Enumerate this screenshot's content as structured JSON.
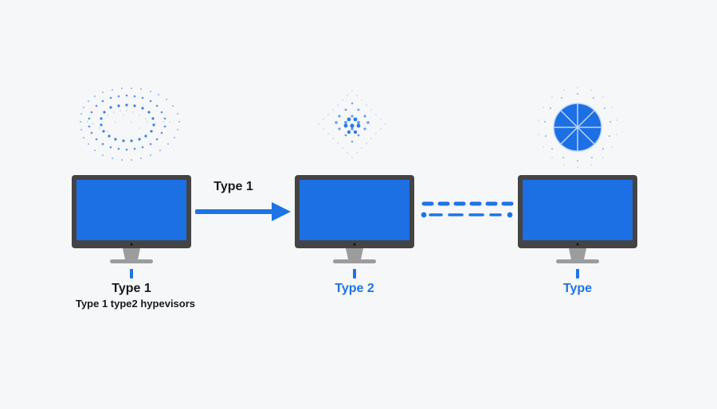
{
  "colors": {
    "accent": "#1d74e6",
    "screen": "#1d6fe4",
    "bezel": "#444444",
    "stand": "#9c9c9c",
    "text_dark": "#1a1a1a"
  },
  "arrow_label": "Type 1",
  "nodes": [
    {
      "caption": "Type 1",
      "caption_color": "black",
      "subcaption": "Type 1 type2 hypevisors",
      "cloud_style": "halftone-ring"
    },
    {
      "caption": "Type 2",
      "caption_color": "blue",
      "subcaption": "",
      "cloud_style": "halftone-diamond"
    },
    {
      "caption": "Type",
      "caption_color": "blue",
      "subcaption": "",
      "cloud_style": "radial-wheel"
    }
  ]
}
